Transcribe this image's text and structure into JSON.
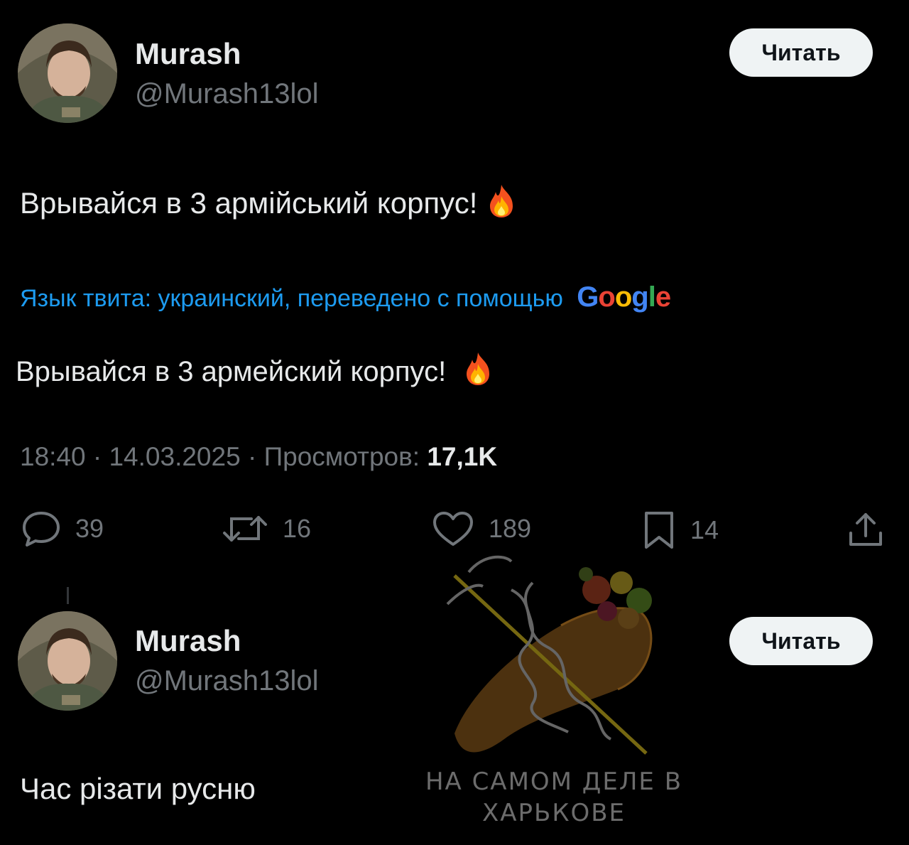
{
  "tweet1": {
    "author_name": "Murash",
    "author_handle": "@Murash13lol",
    "follow_label": "Читать",
    "text": "Врывайся в 3 армійський корпус!",
    "translation_note": "Язык твита: украинский, переведено с помощью",
    "translation_provider": "Google",
    "translated_text": "Врывайся в 3 армейский корпус!",
    "time": "18:40",
    "date": "14.03.2025",
    "views_label": "Просмотров:",
    "views_value": "17,1K",
    "actions": {
      "replies": "39",
      "reposts": "16",
      "likes": "189",
      "bookmarks": "14"
    }
  },
  "tweet2": {
    "author_name": "Murash",
    "author_handle": "@Murash13lol",
    "follow_label": "Читать",
    "text": "Час різати русню"
  },
  "watermark": {
    "line1": "НА САМОМ ДЕЛЕ В",
    "line2": "ХАРЬКОВЕ"
  },
  "icons": {
    "reply": "reply-icon",
    "repost": "repost-icon",
    "like": "heart-icon",
    "bookmark": "bookmark-icon",
    "share": "share-icon",
    "fire": "fire-emoji-icon"
  },
  "colors": {
    "background": "#000000",
    "text": "#e7e9ea",
    "muted": "#71767b",
    "link": "#1d9bf0",
    "button_bg": "#eff3f4"
  }
}
